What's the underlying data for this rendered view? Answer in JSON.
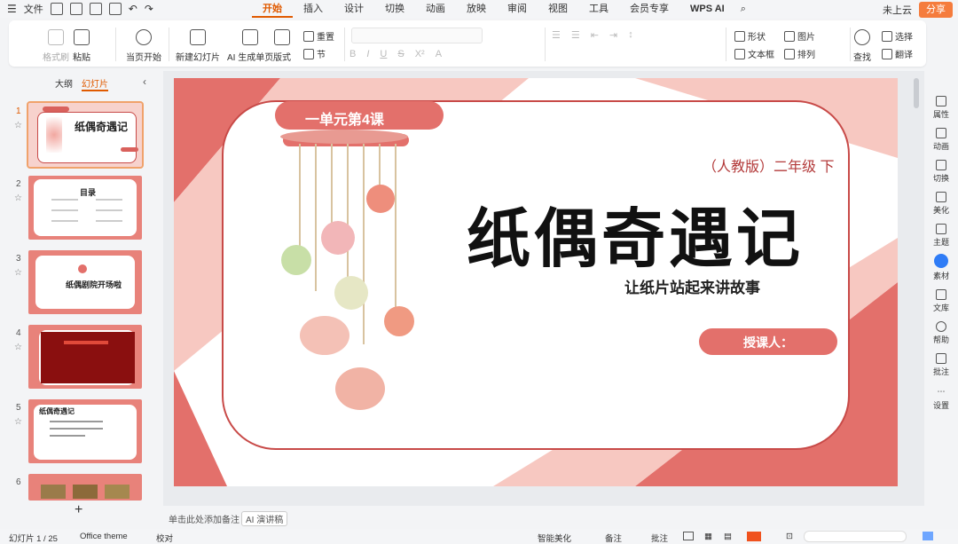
{
  "menubar": {
    "file_label": "文件",
    "tabs": [
      "开始",
      "插入",
      "设计",
      "切换",
      "动画",
      "放映",
      "审阅",
      "视图",
      "工具",
      "会员专享"
    ],
    "active_tab": "开始",
    "wps_ai": "WPS AI",
    "cloud": "未上云",
    "share": "分享"
  },
  "ribbon": {
    "format_painter": "格式刷",
    "paste": "粘贴",
    "start_from_current": "当页开始",
    "new_slide": "新建幻灯片",
    "ai_slide": "AI 生成单页",
    "layout": "版式",
    "reset": "重置",
    "section": "节",
    "shape": "形状",
    "picture": "图片",
    "textbox": "文本框",
    "arrange": "排列",
    "find": "查找",
    "select": "选择",
    "translate": "翻译"
  },
  "left_panel": {
    "tabs": [
      "大纲",
      "幻灯片"
    ],
    "active_tab": "幻灯片",
    "thumbs": [
      {
        "num": "1",
        "title": "纸偶奇遇记"
      },
      {
        "num": "2",
        "title": "目录"
      },
      {
        "num": "3",
        "title": "纸偶剧院开场啦"
      },
      {
        "num": "4",
        "title": ""
      },
      {
        "num": "5",
        "title": "纸偶奇遇记"
      },
      {
        "num": "6",
        "title": ""
      }
    ]
  },
  "slide": {
    "unit_label": "一单元第4课",
    "grade": "（人教版）二年级 下",
    "title": "纸偶奇遇记",
    "subtitle": "让纸片站起来讲故事",
    "teacher": "授课人："
  },
  "notes_placeholder": "单击此处添加备注",
  "ai_speech": "AI 演讲稿",
  "status": {
    "slide_count": "幻灯片 1 / 25",
    "theme": "Office theme",
    "proofread": "校对",
    "beautify": "智能美化",
    "notes": "备注",
    "comments": "批注"
  },
  "right_panel": [
    "属性",
    "动画",
    "切换",
    "美化",
    "主题",
    "素材",
    "文库",
    "帮助",
    "批注",
    "设置"
  ],
  "colors": {
    "accent": "#e05a00",
    "slide_red": "#e3706b",
    "slide_pink": "#f6c3bd"
  }
}
